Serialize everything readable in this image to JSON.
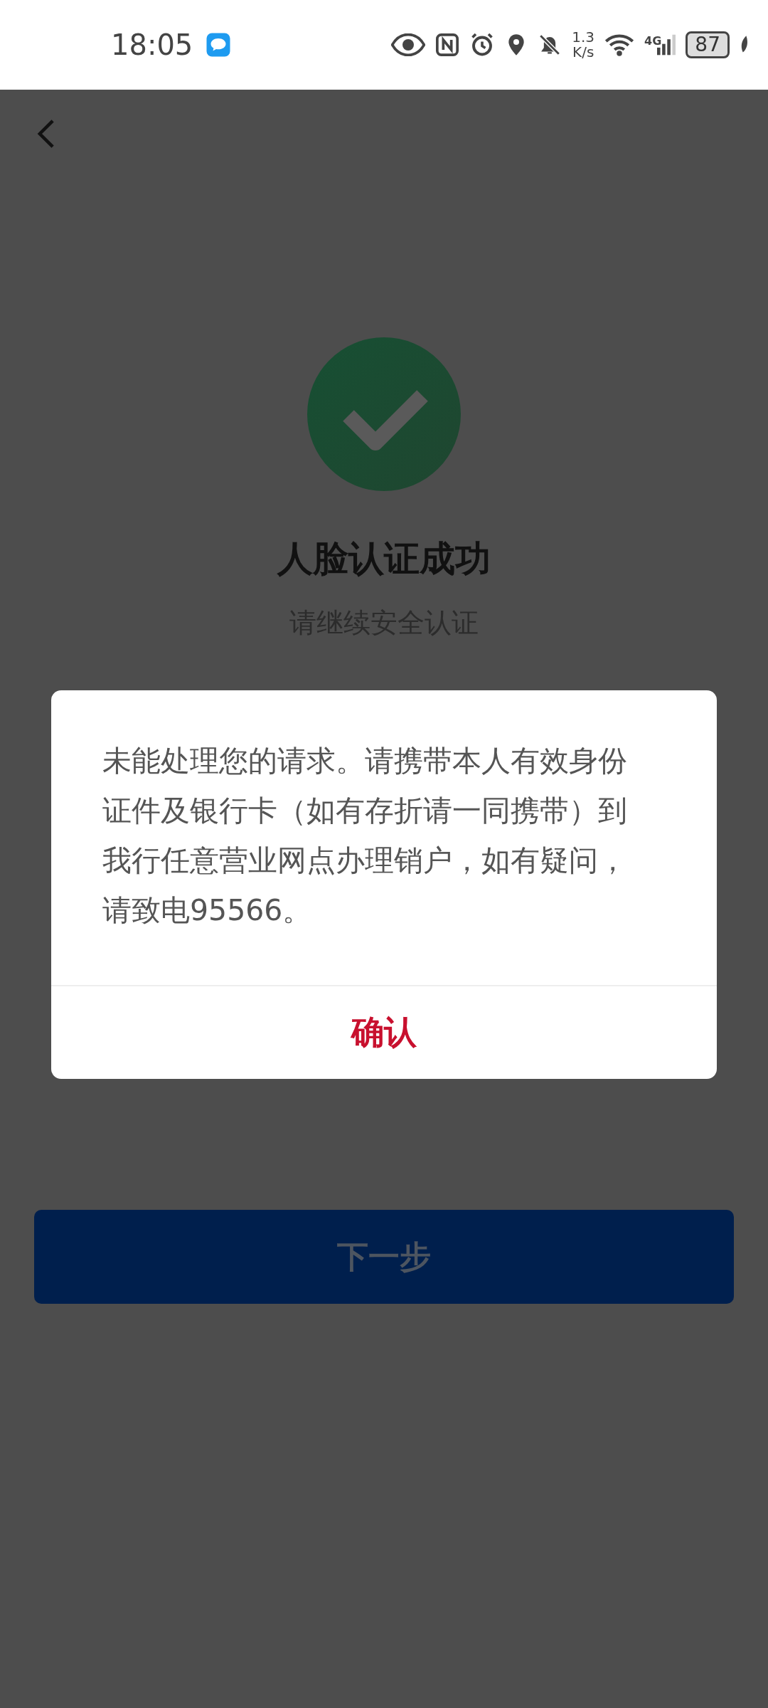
{
  "status_bar": {
    "time": "18:05",
    "speed_value": "1.3",
    "speed_unit": "K/s",
    "network": "4G",
    "battery": "87"
  },
  "page": {
    "title": "人脸认证成功",
    "subtitle": "请继续安全认证",
    "next_button": "下一步"
  },
  "dialog": {
    "message": "未能处理您的请求。请携带本人有效身份证件及银行卡（如有存折请一同携带）到我行任意营业网点办理销户，如有疑问，请致电95566。",
    "confirm_button": "确认"
  }
}
